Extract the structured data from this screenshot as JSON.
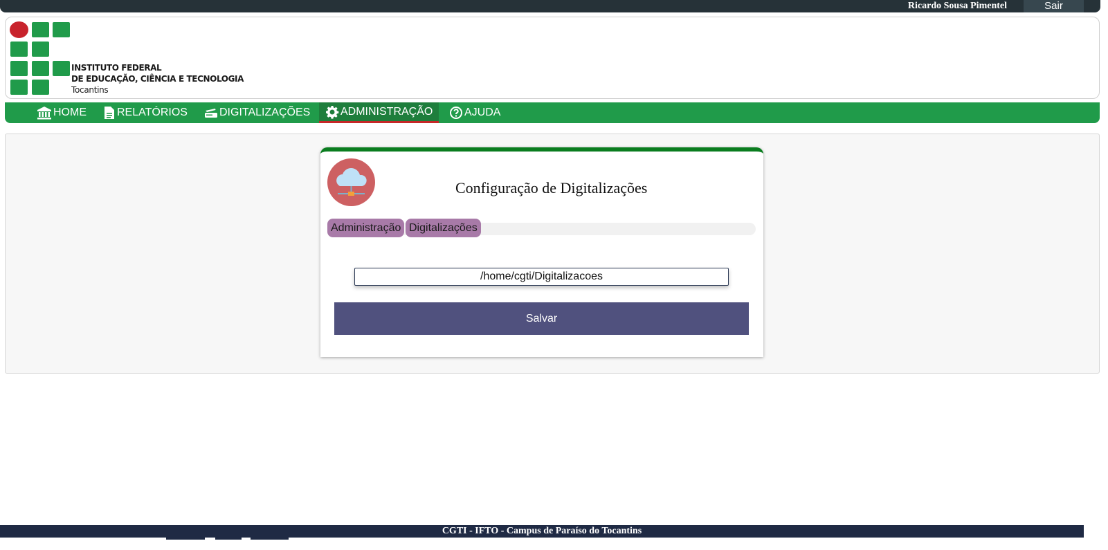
{
  "topbar": {
    "user_name": "Ricardo Sousa Pimentel",
    "logout_label": "Sair"
  },
  "logo": {
    "line1": "INSTITUTO FEDERAL",
    "line2": "DE EDUCAÇÃO, CIÊNCIA E TECNOLOGIA",
    "line3": "Tocantins",
    "colors": {
      "green": "#209b4a",
      "red": "#c8232c"
    }
  },
  "nav": {
    "items": [
      {
        "label": "HOME",
        "icon": "bank-icon"
      },
      {
        "label": "RELATÓRIOS",
        "icon": "document-icon"
      },
      {
        "label": "DIGITALIZAÇÕES",
        "icon": "scanner-icon"
      },
      {
        "label": "ADMINISTRAÇÃO",
        "icon": "gear-icon",
        "active": true
      },
      {
        "label": "AJUDA",
        "icon": "help-circle-icon"
      }
    ],
    "active_underline_color": "#c62828"
  },
  "card": {
    "title": "Configuração de Digitalizações",
    "icon": "cloud-network-icon",
    "breadcrumbs": [
      "Administração",
      "Digitalizações"
    ],
    "path_value": "/home/cgti/Digitalizacoes",
    "save_label": "Salvar",
    "accent_color": "#0a7d1f",
    "button_color": "#50517e"
  },
  "footer": {
    "text": "CGTI - IFTO - Campus de Paraíso do Tocantins"
  }
}
